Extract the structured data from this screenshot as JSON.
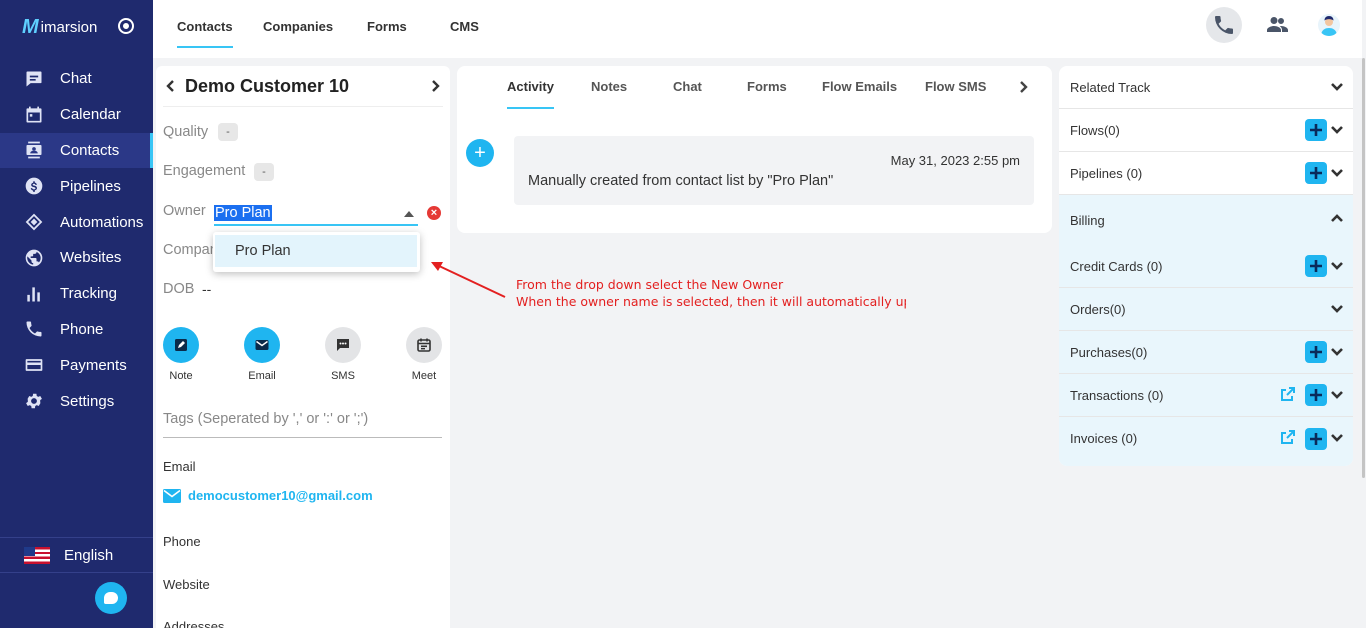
{
  "brand": {
    "logo_letter": "M",
    "name": "imarsion"
  },
  "sidebar": {
    "items": [
      {
        "label": "Chat",
        "icon": "chat-icon"
      },
      {
        "label": "Calendar",
        "icon": "calendar-icon"
      },
      {
        "label": "Contacts",
        "icon": "contacts-icon",
        "active": true
      },
      {
        "label": "Pipelines",
        "icon": "dollar-icon"
      },
      {
        "label": "Automations",
        "icon": "automation-icon"
      },
      {
        "label": "Websites",
        "icon": "globe-icon"
      },
      {
        "label": "Tracking",
        "icon": "bar-chart-icon"
      },
      {
        "label": "Phone",
        "icon": "phone-icon"
      },
      {
        "label": "Payments",
        "icon": "card-icon"
      },
      {
        "label": "Settings",
        "icon": "gear-icon"
      }
    ],
    "language": "English"
  },
  "topbar": {
    "tabs": [
      {
        "label": "Contacts",
        "active": true
      },
      {
        "label": "Companies"
      },
      {
        "label": "Forms"
      },
      {
        "label": "CMS"
      }
    ]
  },
  "contact": {
    "name": "Demo Customer 10",
    "quality_label": "Quality",
    "quality_value": "-",
    "engagement_label": "Engagement",
    "engagement_value": "-",
    "owner_label": "Owner",
    "owner_value": "Pro Plan",
    "company_label": "Compan",
    "dropdown_option": "Pro Plan",
    "dob_label": "DOB",
    "dob_value": "--",
    "actions": [
      {
        "label": "Note"
      },
      {
        "label": "Email"
      },
      {
        "label": "SMS"
      },
      {
        "label": "Meet"
      }
    ],
    "tags_placeholder": "Tags (Seperated by ',' or ':' or ';')",
    "email_label": "Email",
    "email_value": "democustomer10@gmail.com",
    "phone_label": "Phone",
    "website_label": "Website",
    "addresses_label": "Addresses"
  },
  "activity": {
    "tabs": [
      {
        "label": "Activity",
        "active": true
      },
      {
        "label": "Notes"
      },
      {
        "label": "Chat"
      },
      {
        "label": "Forms"
      },
      {
        "label": "Flow Emails"
      },
      {
        "label": "Flow SMS"
      }
    ],
    "plus": "+",
    "entry_date": "May 31, 2023 2:55 pm",
    "entry_text": "Manually created from contact list by \"Pro Plan\""
  },
  "annotation": {
    "line1": "From the drop down select the New Owner",
    "line2": "When the owner name is selected, then it will automatically upda"
  },
  "right_panel": {
    "related_track": "Related Track",
    "flows": "Flows(0)",
    "pipelines": "Pipelines (0)",
    "billing": "Billing",
    "credit_cards": "Credit Cards (0)",
    "orders": "Orders(0)",
    "purchases": "Purchases(0)",
    "transactions": "Transactions (0)",
    "invoices": "Invoices (0)"
  },
  "colors": {
    "sidebar_bg": "#1f2a6e",
    "accent": "#1fb5f0",
    "annotation": "#e32020"
  }
}
